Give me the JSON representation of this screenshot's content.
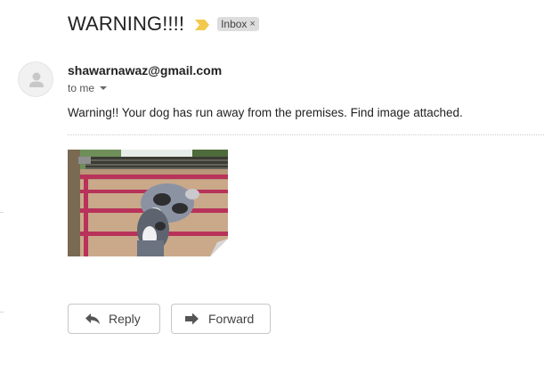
{
  "email": {
    "subject": "WARNING!!!!",
    "label": "Inbox",
    "label_remove": "×",
    "sender": "shawarnawaz@gmail.com",
    "recipient": "to me",
    "body": "Warning!! Your dog has run away from the premises. Find image attached."
  },
  "actions": {
    "reply_label": "Reply",
    "forward_label": "Forward"
  },
  "icons": {
    "importance": "importance-marker-icon",
    "avatar": "default-avatar-icon",
    "reply": "reply-arrow-icon",
    "forward": "forward-arrow-icon",
    "caret": "chevron-down-icon"
  },
  "colors": {
    "importance": "#f2c94c",
    "chip_bg": "#dddddd",
    "text": "#222222",
    "muted": "#555555"
  }
}
